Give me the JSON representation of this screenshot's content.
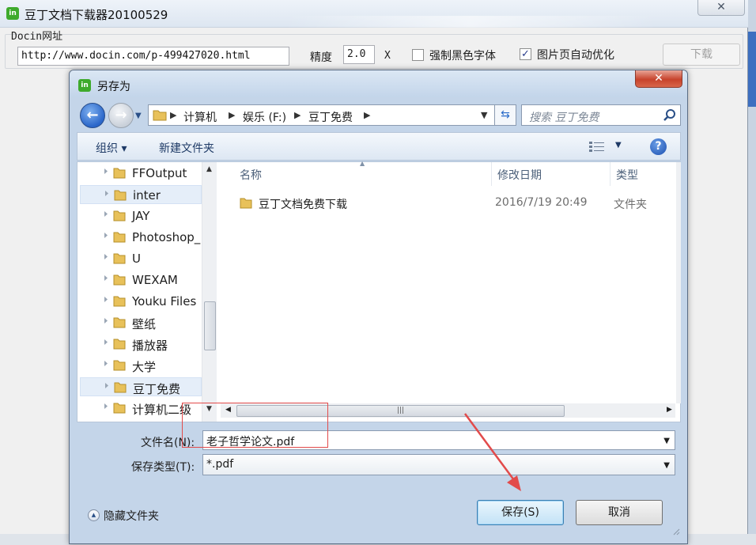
{
  "app": {
    "title": "豆丁文档下载器20100529",
    "close_label": "✕",
    "url_group_label": "Docin网址",
    "url_value": "http://www.docin.com/p-499427020.html",
    "precision_label": "精度",
    "precision_value": "2.0",
    "precision_unit": "X",
    "force_black_label": "强制黑色字体",
    "force_black_checked": false,
    "optimize_label": "图片页自动优化",
    "optimize_checked": true,
    "download_label": "下载"
  },
  "dialog": {
    "title": "另存为",
    "close_label": "✕",
    "breadcrumb": [
      "计算机",
      "娱乐 (F:)",
      "豆丁免费"
    ],
    "search_placeholder": "搜索 豆丁免费",
    "toolbar": {
      "organize_label": "组织 ▾",
      "new_folder_label": "新建文件夹",
      "help_label": "?"
    },
    "tree": [
      {
        "label": "FFOutput",
        "selected": false
      },
      {
        "label": "inter",
        "selected": true
      },
      {
        "label": "JAY",
        "selected": false
      },
      {
        "label": "Photoshop_",
        "selected": false
      },
      {
        "label": "U",
        "selected": false
      },
      {
        "label": "WEXAM",
        "selected": false
      },
      {
        "label": "Youku Files",
        "selected": false
      },
      {
        "label": "壁纸",
        "selected": false
      },
      {
        "label": "播放器",
        "selected": false
      },
      {
        "label": "大学",
        "selected": false
      },
      {
        "label": "豆丁免费",
        "selected": true
      },
      {
        "label": "计算机二级",
        "selected": false
      }
    ],
    "columns": {
      "name": "名称",
      "modified": "修改日期",
      "type": "类型"
    },
    "files": [
      {
        "name": "豆丁文档免费下载",
        "modified": "2016/7/19 20:49",
        "type": "文件夹"
      }
    ],
    "filename_label": "文件名(N):",
    "filename_value": "老子哲学论文.pdf",
    "filetype_label": "保存类型(T):",
    "filetype_value": "*.pdf",
    "hide_folders_label": "隐藏文件夹",
    "save_label": "保存(S)",
    "cancel_label": "取消"
  },
  "colors": {
    "annotation_red": "#e24b4b",
    "accent_blue": "#2a66c9"
  }
}
